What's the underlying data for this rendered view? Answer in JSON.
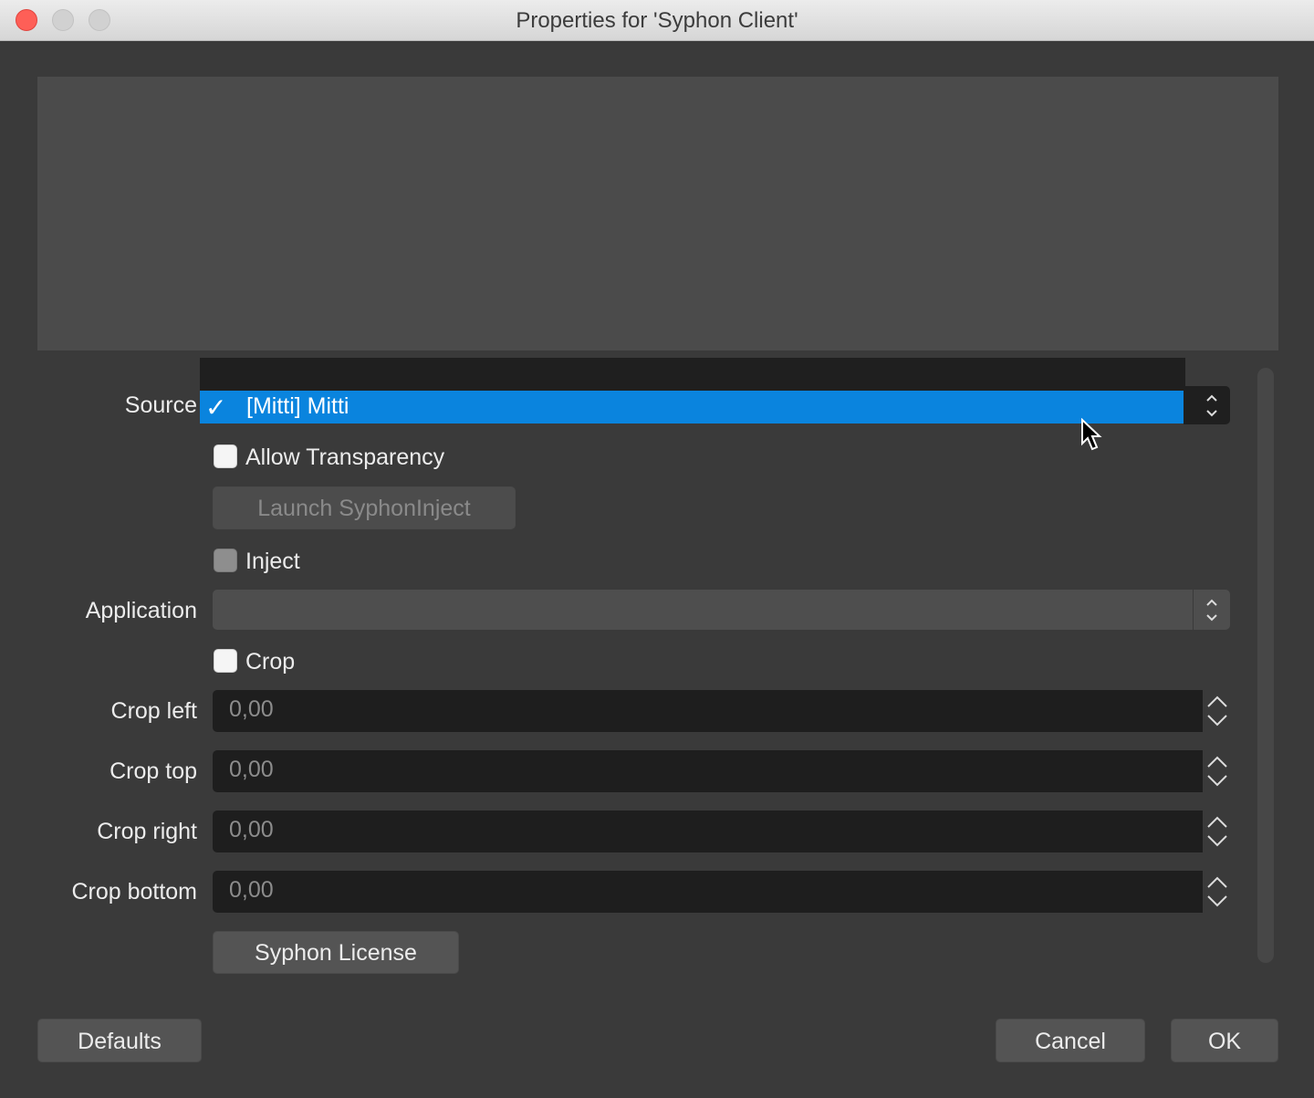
{
  "window": {
    "title": "Properties for 'Syphon Client'"
  },
  "source": {
    "label": "Source",
    "selected": "[Mitti] Mitti",
    "check": "✓"
  },
  "allow_transparency": {
    "label": "Allow Transparency",
    "checked": false
  },
  "launch_button": {
    "label": "Launch SyphonInject",
    "enabled": false
  },
  "inject": {
    "label": "Inject",
    "checked": false,
    "enabled": false
  },
  "application": {
    "label": "Application",
    "value": ""
  },
  "crop": {
    "label": "Crop",
    "checked": false
  },
  "crop_fields": [
    {
      "label": "Crop left",
      "value": "0,00"
    },
    {
      "label": "Crop top",
      "value": "0,00"
    },
    {
      "label": "Crop right",
      "value": "0,00"
    },
    {
      "label": "Crop bottom",
      "value": "0,00"
    }
  ],
  "license_button": {
    "label": "Syphon License"
  },
  "footer": {
    "defaults": "Defaults",
    "cancel": "Cancel",
    "ok": "OK"
  },
  "colors": {
    "accent": "#0a84de",
    "background": "#3a3a3a",
    "close": "#fe5f57"
  }
}
